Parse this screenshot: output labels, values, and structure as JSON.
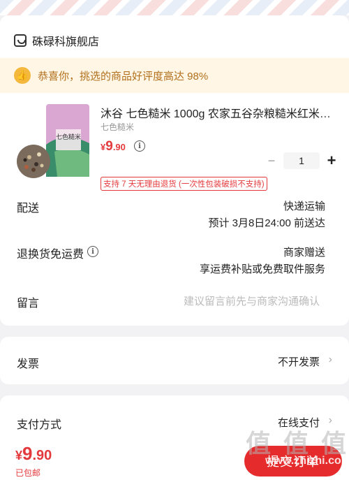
{
  "store": {
    "name": "硃碌科旗舰店",
    "icon": "store-icon"
  },
  "promo": {
    "text": "恭喜你，挑选的商品好评度高达 98%",
    "icon": "thumbs-up-icon"
  },
  "product": {
    "title": "沐谷 七色糙米 1000g 农家五谷杂粮糙米红米…",
    "spec": "七色糙米",
    "price_symbol": "¥",
    "price_int": "9",
    "price_dec": ".90",
    "quantity": "1",
    "minus": "−",
    "plus": "+",
    "guarantee": "支持 7 天无理由退货 (一次性包装破损不支持)",
    "image_label": "七色糙米"
  },
  "delivery": {
    "label": "配送",
    "method": "快递运输",
    "eta": "预计 3月8日24:00 前送达"
  },
  "return_shipping": {
    "label": "退换货免运费",
    "value": "商家赠送",
    "desc": "享运费补贴或免费取件服务"
  },
  "message": {
    "label": "留言",
    "placeholder": "建议留言前先与商家沟通确认"
  },
  "invoice": {
    "label": "发票",
    "value": "不开发票"
  },
  "payment": {
    "label": "支付方式",
    "value": "在线支付"
  },
  "bottom": {
    "price_symbol": "¥",
    "price_int": "9",
    "price_dec": ".90",
    "shipping": "已包邮",
    "submit": "提交订单"
  },
  "watermark": {
    "text": "值 值 值",
    "url": "www.zhizhi.com"
  },
  "colors": {
    "accent": "#e52b2b",
    "price": "#e4393c",
    "promo_bg": "#fff6e6",
    "promo_text": "#b2701c"
  }
}
